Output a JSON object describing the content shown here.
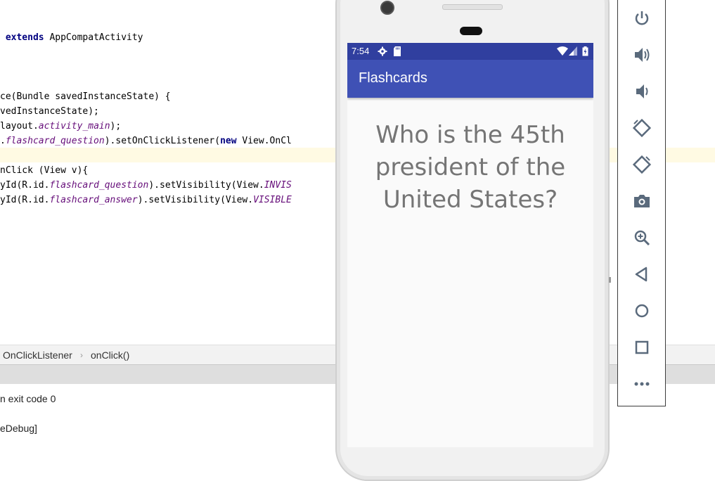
{
  "editor": {
    "lines": [
      {
        "parts": [
          {
            "t": "kw",
            "v": " extends"
          },
          {
            "t": "p",
            "v": " AppCompatActivity"
          }
        ]
      },
      {
        "parts": [
          {
            "t": "p",
            "v": "ce(Bundle savedInstanceState) {"
          }
        ]
      },
      {
        "parts": [
          {
            "t": "p",
            "v": "vedInstanceState);"
          }
        ]
      },
      {
        "parts": [
          {
            "t": "p",
            "v": "layout."
          },
          {
            "t": "fld",
            "v": "activity_main"
          },
          {
            "t": "p",
            "v": ");"
          }
        ]
      },
      {
        "parts": [
          {
            "t": "p",
            "v": "."
          },
          {
            "t": "fld",
            "v": "flashcard_question"
          },
          {
            "t": "p",
            "v": ").setOnClickListener("
          },
          {
            "t": "kw",
            "v": "new"
          },
          {
            "t": "p",
            "v": " View.OnCl"
          }
        ]
      },
      {
        "parts": [
          {
            "t": "p",
            "v": "nClick (View v){"
          }
        ]
      },
      {
        "parts": [
          {
            "t": "p",
            "v": "yId(R.id."
          },
          {
            "t": "fld",
            "v": "flashcard_question"
          },
          {
            "t": "p",
            "v": ").setVisibility(View."
          },
          {
            "t": "fld",
            "v": "INVIS"
          }
        ]
      },
      {
        "parts": [
          {
            "t": "p",
            "v": "yId(R.id."
          },
          {
            "t": "fld",
            "v": "flashcard_answer"
          },
          {
            "t": "p",
            "v": ").setVisibility(View."
          },
          {
            "t": "fld",
            "v": "VISIBLE"
          }
        ]
      }
    ]
  },
  "breadcrumb": {
    "item1": "OnClickListener",
    "separator": "›",
    "item2": "onClick()"
  },
  "console": {
    "line1": "n exit code 0",
    "line2": "eDebug]"
  },
  "phone": {
    "status_time": "7:54",
    "app_title": "Flashcards",
    "question_text": "Who is the 45th president of the United States?"
  },
  "toolbar": {
    "buttons": [
      "power-icon",
      "volume-up-icon",
      "volume-down-icon",
      "rotate-left-icon",
      "rotate-right-icon",
      "camera-icon",
      "zoom-icon",
      "back-icon",
      "home-icon",
      "overview-icon",
      "more-icon"
    ]
  },
  "colors": {
    "app_bar": "#3f51b5",
    "status_bar": "#303f9f",
    "question_text": "#757575",
    "keyword": "#000080",
    "field": "#660e7a"
  }
}
